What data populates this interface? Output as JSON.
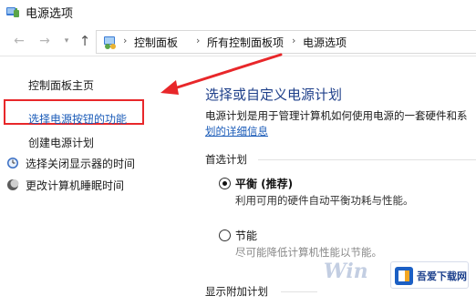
{
  "window": {
    "title": "电源选项",
    "icon": "power-options-icon"
  },
  "nav": {
    "back_icon": "arrow-left-icon",
    "forward_icon": "arrow-right-icon",
    "recent_icon": "chevron-down-icon",
    "up_icon": "arrow-up-icon",
    "address_icon": "control-panel-icon",
    "breadcrumbs": [
      "控制面板",
      "所有控制面板项",
      "电源选项"
    ]
  },
  "sidebar": {
    "home": "控制面板主页",
    "highlighted_link": "选择电源按钮的功能",
    "create_plan": "创建电源计划",
    "items": [
      {
        "label": "选择关闭显示器的时间",
        "icon": "monitor-clock-icon"
      },
      {
        "label": "更改计算机睡眠时间",
        "icon": "moon-sleep-icon"
      }
    ]
  },
  "main": {
    "title": "选择或自定义电源计划",
    "description": "电源计划是用于管理计算机如何使用电源的一套硬件和系",
    "description_link": "划的详细信息",
    "preferred_label": "首选计划",
    "plans": [
      {
        "name": "平衡 (推荐)",
        "desc": "利用可用的硬件自动平衡功耗与性能。",
        "selected": true
      },
      {
        "name": "节能",
        "desc": "尽可能降低计算机性能以节能。",
        "selected": false
      }
    ],
    "additional_label": "显示附加计划"
  },
  "annotation": {
    "arrow_color": "#e8272a",
    "box_color": "#e8272a"
  },
  "watermark": {
    "text": "Win",
    "badge_text": "吾爱下载网"
  }
}
